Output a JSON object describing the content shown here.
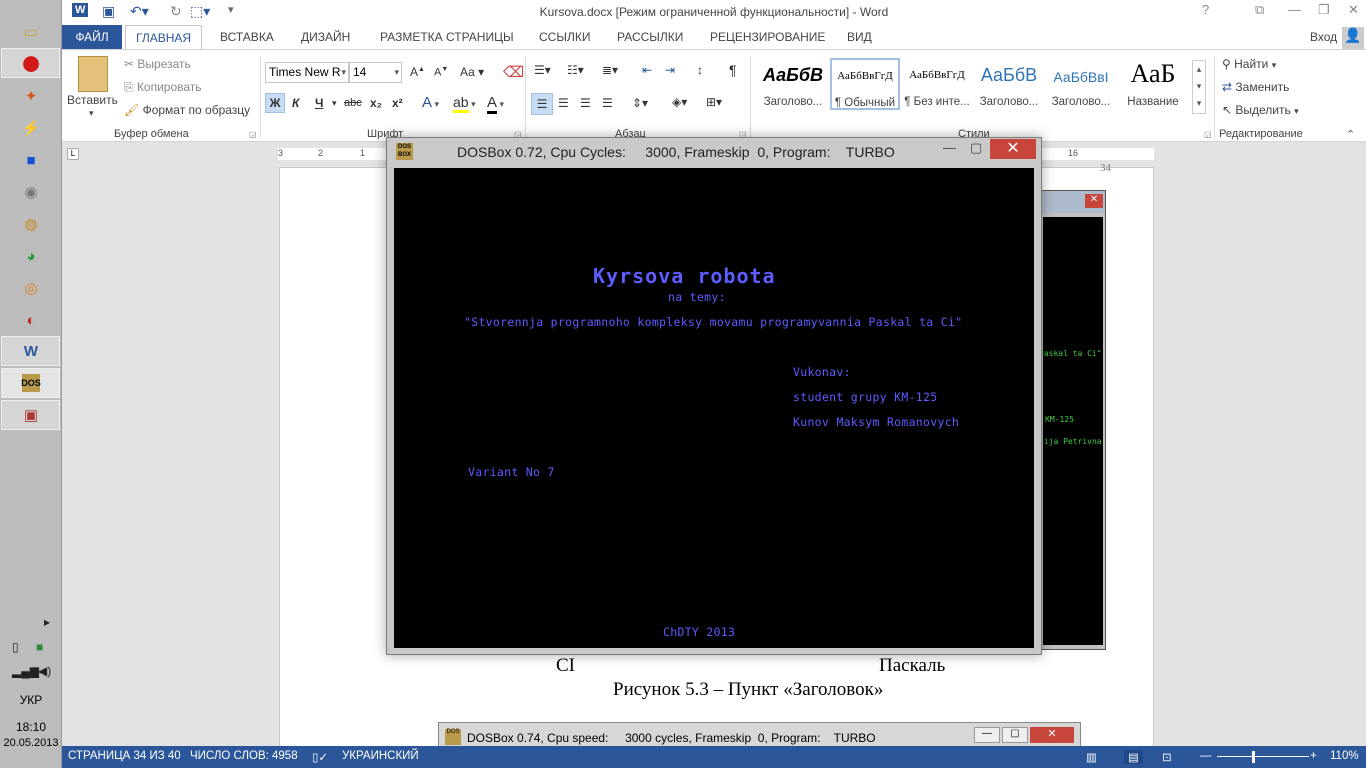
{
  "app": {
    "title": "Kursova.docx [Режим ограниченной функциональности] - Word",
    "sign_in": "Вход"
  },
  "tabs": [
    "ФАЙЛ",
    "ГЛАВНАЯ",
    "ВСТАВКА",
    "ДИЗАЙН",
    "РАЗМЕТКА СТРАНИЦЫ",
    "ССЫЛКИ",
    "РАССЫЛКИ",
    "РЕЦЕНЗИРОВАНИЕ",
    "ВИД"
  ],
  "ribbon": {
    "clipboard": {
      "paste": "Вставить",
      "cut": "Вырезать",
      "copy": "Копировать",
      "format_painter": "Формат по образцу",
      "label": "Буфер обмена"
    },
    "font": {
      "name": "Times New R",
      "size": "14",
      "label": "Шрифт",
      "bold": "Ж",
      "italic": "К",
      "underline": "Ч",
      "strike": "abc",
      "sub": "x₂",
      "sup": "x²",
      "case": "Аа"
    },
    "paragraph": {
      "label": "Абзац",
      "pilcrow": "¶"
    },
    "styles": {
      "label": "Стили",
      "items": [
        {
          "sample": "АаБбВ",
          "name": "Заголово..."
        },
        {
          "sample": "АаБбВвГгД",
          "name": "¶ Обычный"
        },
        {
          "sample": "АаБбВвГгД",
          "name": "¶ Без инте..."
        },
        {
          "sample": "АаБбВ",
          "name": "Заголово..."
        },
        {
          "sample": "АаБбВвI",
          "name": "Заголово..."
        },
        {
          "sample": "АаБ",
          "name": "Название"
        }
      ]
    },
    "editing": {
      "label": "Редактирование",
      "find": "Найти",
      "replace": "Заменить",
      "select": "Выделить"
    }
  },
  "ruler": {
    "marks": [
      "3",
      "2",
      "1",
      "16"
    ]
  },
  "document": {
    "page_number": "34",
    "caption_left": "СІ",
    "caption_right": "Паскаль",
    "figure_caption": "Рисунок 5.3 – Пункт «Заголовок»",
    "bg_dos_lines": [
      "Paskal ta Ci\"",
      "KM-125",
      "rija Petrivna"
    ],
    "bottom_dosbox_title": "DOSBox 0.74, Cpu speed:     3000 cycles, Frameskip  0, Program:    TURBO"
  },
  "dosbox": {
    "title": "DOSBox 0.72, Cpu Cycles:     3000, Frameskip  0, Program:    TURBO",
    "icon_text": "DOS BOX",
    "lines": {
      "title": "Kyrsova robota",
      "subtitle": "na temy:",
      "topic": "\"Stvorennja programnoho kompleksy movamu programyvannia Paskal ta Ci\"",
      "performed": "Vukonav:",
      "group": "student grupy KM-125",
      "name": "Kunov Maksym Romanovych",
      "variant": "Variant No 7",
      "footer": "ChDTY 2013"
    }
  },
  "statusbar": {
    "page": "СТРАНИЦА 34 ИЗ 40",
    "words": "ЧИСЛО СЛОВ: 4958",
    "lang": "УКРАИНСКИЙ",
    "zoom": "110%"
  },
  "taskbar": {
    "lang": "УКР",
    "time": "18:10",
    "date": "20.05.2013"
  }
}
